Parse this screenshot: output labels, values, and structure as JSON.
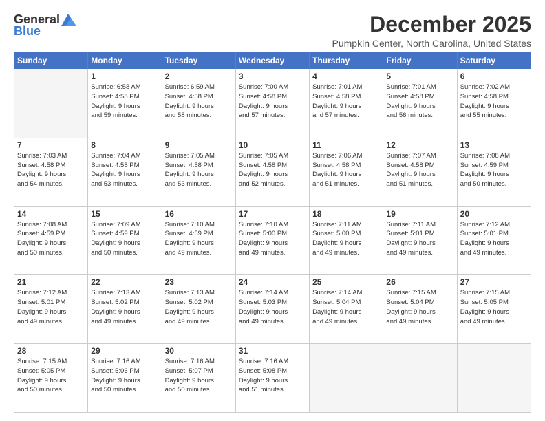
{
  "logo": {
    "general": "General",
    "blue": "Blue"
  },
  "title": "December 2025",
  "location": "Pumpkin Center, North Carolina, United States",
  "days_header": [
    "Sunday",
    "Monday",
    "Tuesday",
    "Wednesday",
    "Thursday",
    "Friday",
    "Saturday"
  ],
  "weeks": [
    [
      {
        "day": "",
        "info": ""
      },
      {
        "day": "1",
        "info": "Sunrise: 6:58 AM\nSunset: 4:58 PM\nDaylight: 9 hours\nand 59 minutes."
      },
      {
        "day": "2",
        "info": "Sunrise: 6:59 AM\nSunset: 4:58 PM\nDaylight: 9 hours\nand 58 minutes."
      },
      {
        "day": "3",
        "info": "Sunrise: 7:00 AM\nSunset: 4:58 PM\nDaylight: 9 hours\nand 57 minutes."
      },
      {
        "day": "4",
        "info": "Sunrise: 7:01 AM\nSunset: 4:58 PM\nDaylight: 9 hours\nand 57 minutes."
      },
      {
        "day": "5",
        "info": "Sunrise: 7:01 AM\nSunset: 4:58 PM\nDaylight: 9 hours\nand 56 minutes."
      },
      {
        "day": "6",
        "info": "Sunrise: 7:02 AM\nSunset: 4:58 PM\nDaylight: 9 hours\nand 55 minutes."
      }
    ],
    [
      {
        "day": "7",
        "info": "Sunrise: 7:03 AM\nSunset: 4:58 PM\nDaylight: 9 hours\nand 54 minutes."
      },
      {
        "day": "8",
        "info": "Sunrise: 7:04 AM\nSunset: 4:58 PM\nDaylight: 9 hours\nand 53 minutes."
      },
      {
        "day": "9",
        "info": "Sunrise: 7:05 AM\nSunset: 4:58 PM\nDaylight: 9 hours\nand 53 minutes."
      },
      {
        "day": "10",
        "info": "Sunrise: 7:05 AM\nSunset: 4:58 PM\nDaylight: 9 hours\nand 52 minutes."
      },
      {
        "day": "11",
        "info": "Sunrise: 7:06 AM\nSunset: 4:58 PM\nDaylight: 9 hours\nand 51 minutes."
      },
      {
        "day": "12",
        "info": "Sunrise: 7:07 AM\nSunset: 4:58 PM\nDaylight: 9 hours\nand 51 minutes."
      },
      {
        "day": "13",
        "info": "Sunrise: 7:08 AM\nSunset: 4:59 PM\nDaylight: 9 hours\nand 50 minutes."
      }
    ],
    [
      {
        "day": "14",
        "info": "Sunrise: 7:08 AM\nSunset: 4:59 PM\nDaylight: 9 hours\nand 50 minutes."
      },
      {
        "day": "15",
        "info": "Sunrise: 7:09 AM\nSunset: 4:59 PM\nDaylight: 9 hours\nand 50 minutes."
      },
      {
        "day": "16",
        "info": "Sunrise: 7:10 AM\nSunset: 4:59 PM\nDaylight: 9 hours\nand 49 minutes."
      },
      {
        "day": "17",
        "info": "Sunrise: 7:10 AM\nSunset: 5:00 PM\nDaylight: 9 hours\nand 49 minutes."
      },
      {
        "day": "18",
        "info": "Sunrise: 7:11 AM\nSunset: 5:00 PM\nDaylight: 9 hours\nand 49 minutes."
      },
      {
        "day": "19",
        "info": "Sunrise: 7:11 AM\nSunset: 5:01 PM\nDaylight: 9 hours\nand 49 minutes."
      },
      {
        "day": "20",
        "info": "Sunrise: 7:12 AM\nSunset: 5:01 PM\nDaylight: 9 hours\nand 49 minutes."
      }
    ],
    [
      {
        "day": "21",
        "info": "Sunrise: 7:12 AM\nSunset: 5:01 PM\nDaylight: 9 hours\nand 49 minutes."
      },
      {
        "day": "22",
        "info": "Sunrise: 7:13 AM\nSunset: 5:02 PM\nDaylight: 9 hours\nand 49 minutes."
      },
      {
        "day": "23",
        "info": "Sunrise: 7:13 AM\nSunset: 5:02 PM\nDaylight: 9 hours\nand 49 minutes."
      },
      {
        "day": "24",
        "info": "Sunrise: 7:14 AM\nSunset: 5:03 PM\nDaylight: 9 hours\nand 49 minutes."
      },
      {
        "day": "25",
        "info": "Sunrise: 7:14 AM\nSunset: 5:04 PM\nDaylight: 9 hours\nand 49 minutes."
      },
      {
        "day": "26",
        "info": "Sunrise: 7:15 AM\nSunset: 5:04 PM\nDaylight: 9 hours\nand 49 minutes."
      },
      {
        "day": "27",
        "info": "Sunrise: 7:15 AM\nSunset: 5:05 PM\nDaylight: 9 hours\nand 49 minutes."
      }
    ],
    [
      {
        "day": "28",
        "info": "Sunrise: 7:15 AM\nSunset: 5:05 PM\nDaylight: 9 hours\nand 50 minutes."
      },
      {
        "day": "29",
        "info": "Sunrise: 7:16 AM\nSunset: 5:06 PM\nDaylight: 9 hours\nand 50 minutes."
      },
      {
        "day": "30",
        "info": "Sunrise: 7:16 AM\nSunset: 5:07 PM\nDaylight: 9 hours\nand 50 minutes."
      },
      {
        "day": "31",
        "info": "Sunrise: 7:16 AM\nSunset: 5:08 PM\nDaylight: 9 hours\nand 51 minutes."
      },
      {
        "day": "",
        "info": ""
      },
      {
        "day": "",
        "info": ""
      },
      {
        "day": "",
        "info": ""
      }
    ]
  ]
}
